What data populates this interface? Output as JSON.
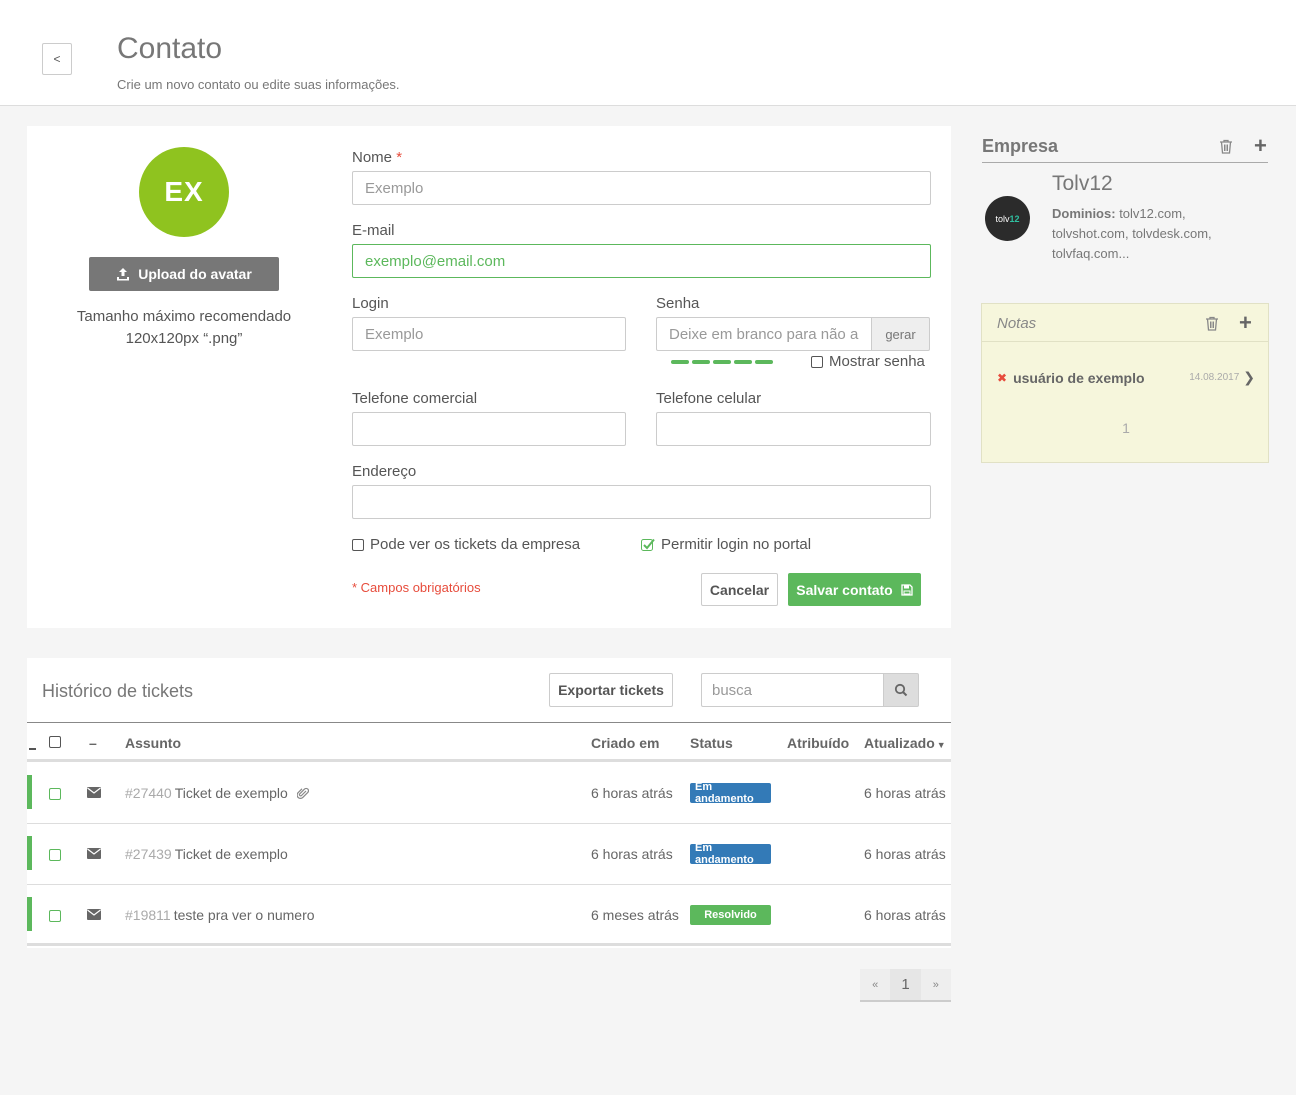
{
  "header": {
    "back_label": "<",
    "title": "Contato",
    "subtitle": "Crie um novo contato ou edite suas informações."
  },
  "avatar": {
    "initials": "EX",
    "color": "#8fc31f",
    "upload_label": "Upload do avatar",
    "note": "Tamanho máximo recomendado 120x120px “.png”"
  },
  "form": {
    "nome_label": "Nome",
    "required_mark": "*",
    "nome_placeholder": "Exemplo",
    "email_label": "E-mail",
    "email_value": "exemplo@email.com",
    "login_label": "Login",
    "login_placeholder": "Exemplo",
    "senha_label": "Senha",
    "senha_placeholder": "Deixe em branco para não alterar",
    "gerar_label": "gerar",
    "show_password_label": "Mostrar senha",
    "tel_comercial_label": "Telefone comercial",
    "tel_celular_label": "Telefone celular",
    "endereco_label": "Endereço",
    "ver_tickets_label": "Pode ver os tickets da empresa",
    "permitir_login_label": "Permitir login no portal",
    "required_note": "* Campos obrigatórios",
    "cancel_label": "Cancelar",
    "save_label": "Salvar contato"
  },
  "company": {
    "section_title": "Empresa",
    "logo_text_a": "tolv",
    "logo_text_b": "12",
    "name": "Tolv12",
    "domains_label": "Dominios:",
    "domains": "tolv12.com, tolvshot.com, tolvdesk.com, tolvfaq.com..."
  },
  "notes": {
    "title": "Notas",
    "items": [
      {
        "text": "usuário de exemplo",
        "date": "14.08.2017"
      }
    ],
    "page": "1"
  },
  "tickets": {
    "title": "Histórico de tickets",
    "export_label": "Exportar tickets",
    "search_placeholder": "busca",
    "columns": {
      "dash": "–",
      "subject": "Assunto",
      "created": "Criado em",
      "status": "Status",
      "assigned": "Atribuído",
      "updated": "Atualizado"
    },
    "rows": [
      {
        "number": "#27440",
        "subject": "Ticket de exemplo",
        "attachment": true,
        "created": "6 horas atrás",
        "status": "Em andamento",
        "status_color": "#337ab7",
        "updated": "6 horas atrás"
      },
      {
        "number": "#27439",
        "subject": "Ticket de exemplo",
        "attachment": false,
        "created": "6 horas atrás",
        "status": "Em andamento",
        "status_color": "#337ab7",
        "updated": "6 horas atrás"
      },
      {
        "number": "#19811",
        "subject": "teste pra ver o numero",
        "attachment": false,
        "created": "6 meses atrás",
        "status": "Resolvido",
        "status_color": "#5cb85c",
        "updated": "6 horas atrás"
      }
    ],
    "pager": {
      "prev": "«",
      "current": "1",
      "next": "»"
    }
  }
}
